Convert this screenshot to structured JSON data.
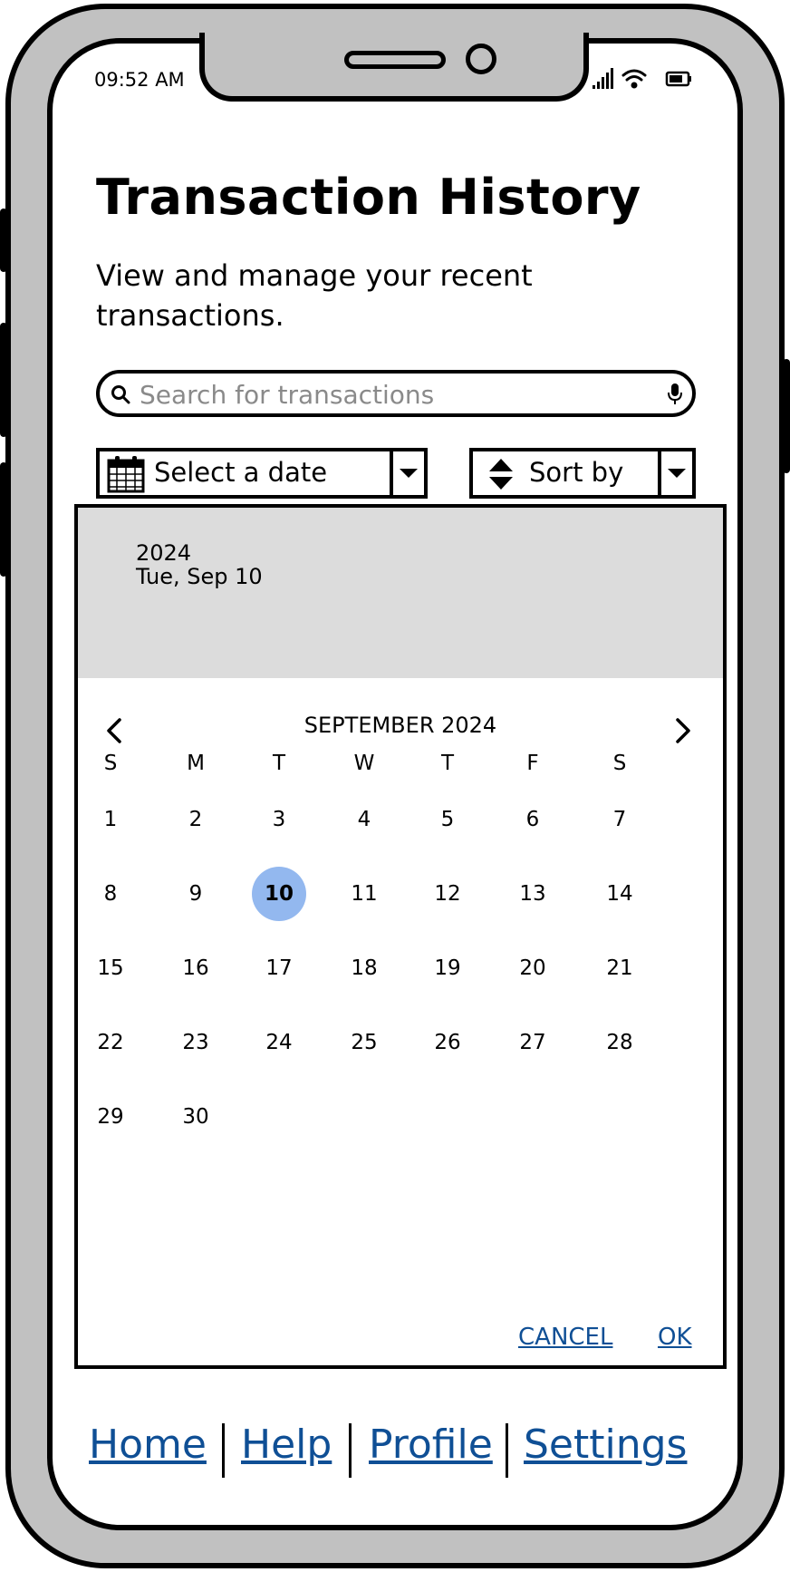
{
  "status_bar": {
    "time": "09:52 AM",
    "icons": [
      "signal-icon",
      "wifi-icon",
      "battery-icon"
    ]
  },
  "page": {
    "title": "Transaction History",
    "subtitle": "View and manage your recent transactions."
  },
  "search": {
    "placeholder": "Search for transactions",
    "value": ""
  },
  "filters": {
    "date_label": "Select a date",
    "sort_label": "Sort by"
  },
  "picker": {
    "year": "2024",
    "selected_date_text": "Tue, Sep 10",
    "month_label": "SEPTEMBER 2024",
    "weekdays": [
      "S",
      "M",
      "T",
      "W",
      "T",
      "F",
      "S"
    ],
    "days": [
      "1",
      "2",
      "3",
      "4",
      "5",
      "6",
      "7",
      "8",
      "9",
      "10",
      "11",
      "12",
      "13",
      "14",
      "15",
      "16",
      "17",
      "18",
      "19",
      "20",
      "21",
      "22",
      "23",
      "24",
      "25",
      "26",
      "27",
      "28",
      "29",
      "30"
    ],
    "selected_day": "10",
    "selected_color": "#93b8ef",
    "cancel_label": "CANCEL",
    "ok_label": "OK"
  },
  "bottom_nav": {
    "items": [
      "Home",
      "Help",
      "Profile",
      "Settings"
    ],
    "link_color": "#0f4f95"
  }
}
